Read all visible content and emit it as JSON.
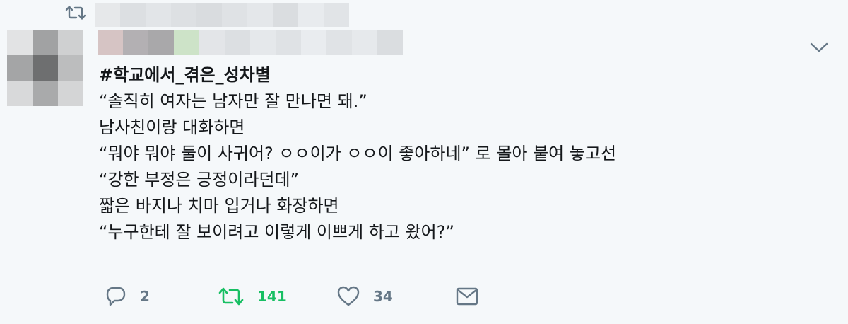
{
  "tweet": {
    "hashtag": "#학교에서_겪은_성차별",
    "lines": [
      "“솔직히 여자는 남자만 잘 만나면 돼.”",
      "남사친이랑 대화하면",
      "“뭐야 뭐야 둘이 사귀어? ㅇㅇ이가 ㅇㅇ이 좋아하네” 로 몰아 붙여 놓고선",
      "“강한 부정은 긍정이라던데”",
      "짧은 바지나 치마 입거나 화장하면",
      "“누구한테 잘 보이려고 이렇게 이쁘게 하고 왔어?”"
    ]
  },
  "actions": {
    "reply_count": "2",
    "retweet_count": "141",
    "like_count": "34"
  },
  "icons": {
    "retweet_context": "retweet-icon",
    "more": "chevron-down-icon",
    "reply": "reply-icon",
    "retweet": "retweet-icon",
    "like": "heart-icon",
    "dm": "envelope-icon"
  },
  "colors": {
    "background": "#f5f8fa",
    "text": "#14171a",
    "muted": "#657786",
    "retweet_active": "#17bf63"
  }
}
